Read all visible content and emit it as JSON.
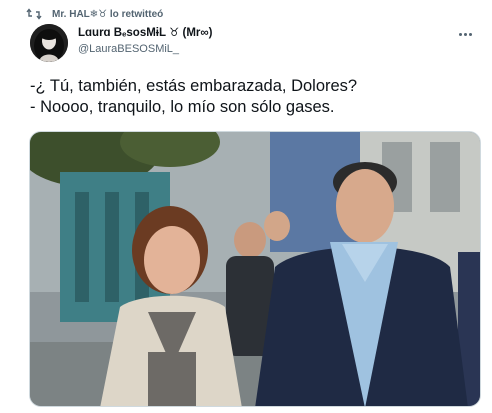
{
  "retweet": {
    "icon": "retweet-icon",
    "text": "Mr. HAL❄︎♉ lo retwitteó"
  },
  "tweet": {
    "avatar_icon": "avatar-portrait",
    "display_name": "Lɑurɑ BₑsosMɨL ♉ (Mr∞)",
    "handle": "@LauraBESOSMiL_",
    "text_lines": [
      "-¿ Tú, también, estás embarazada, Dolores?",
      "- Noooo, tranquilo, lo mío son sólo gases."
    ],
    "more_icon": "more-options-icon",
    "media_description_icon": "photo-two-people-walking"
  },
  "colors": {
    "text_primary": "#0f1419",
    "text_secondary": "#536471",
    "border": "#cfd9de"
  }
}
